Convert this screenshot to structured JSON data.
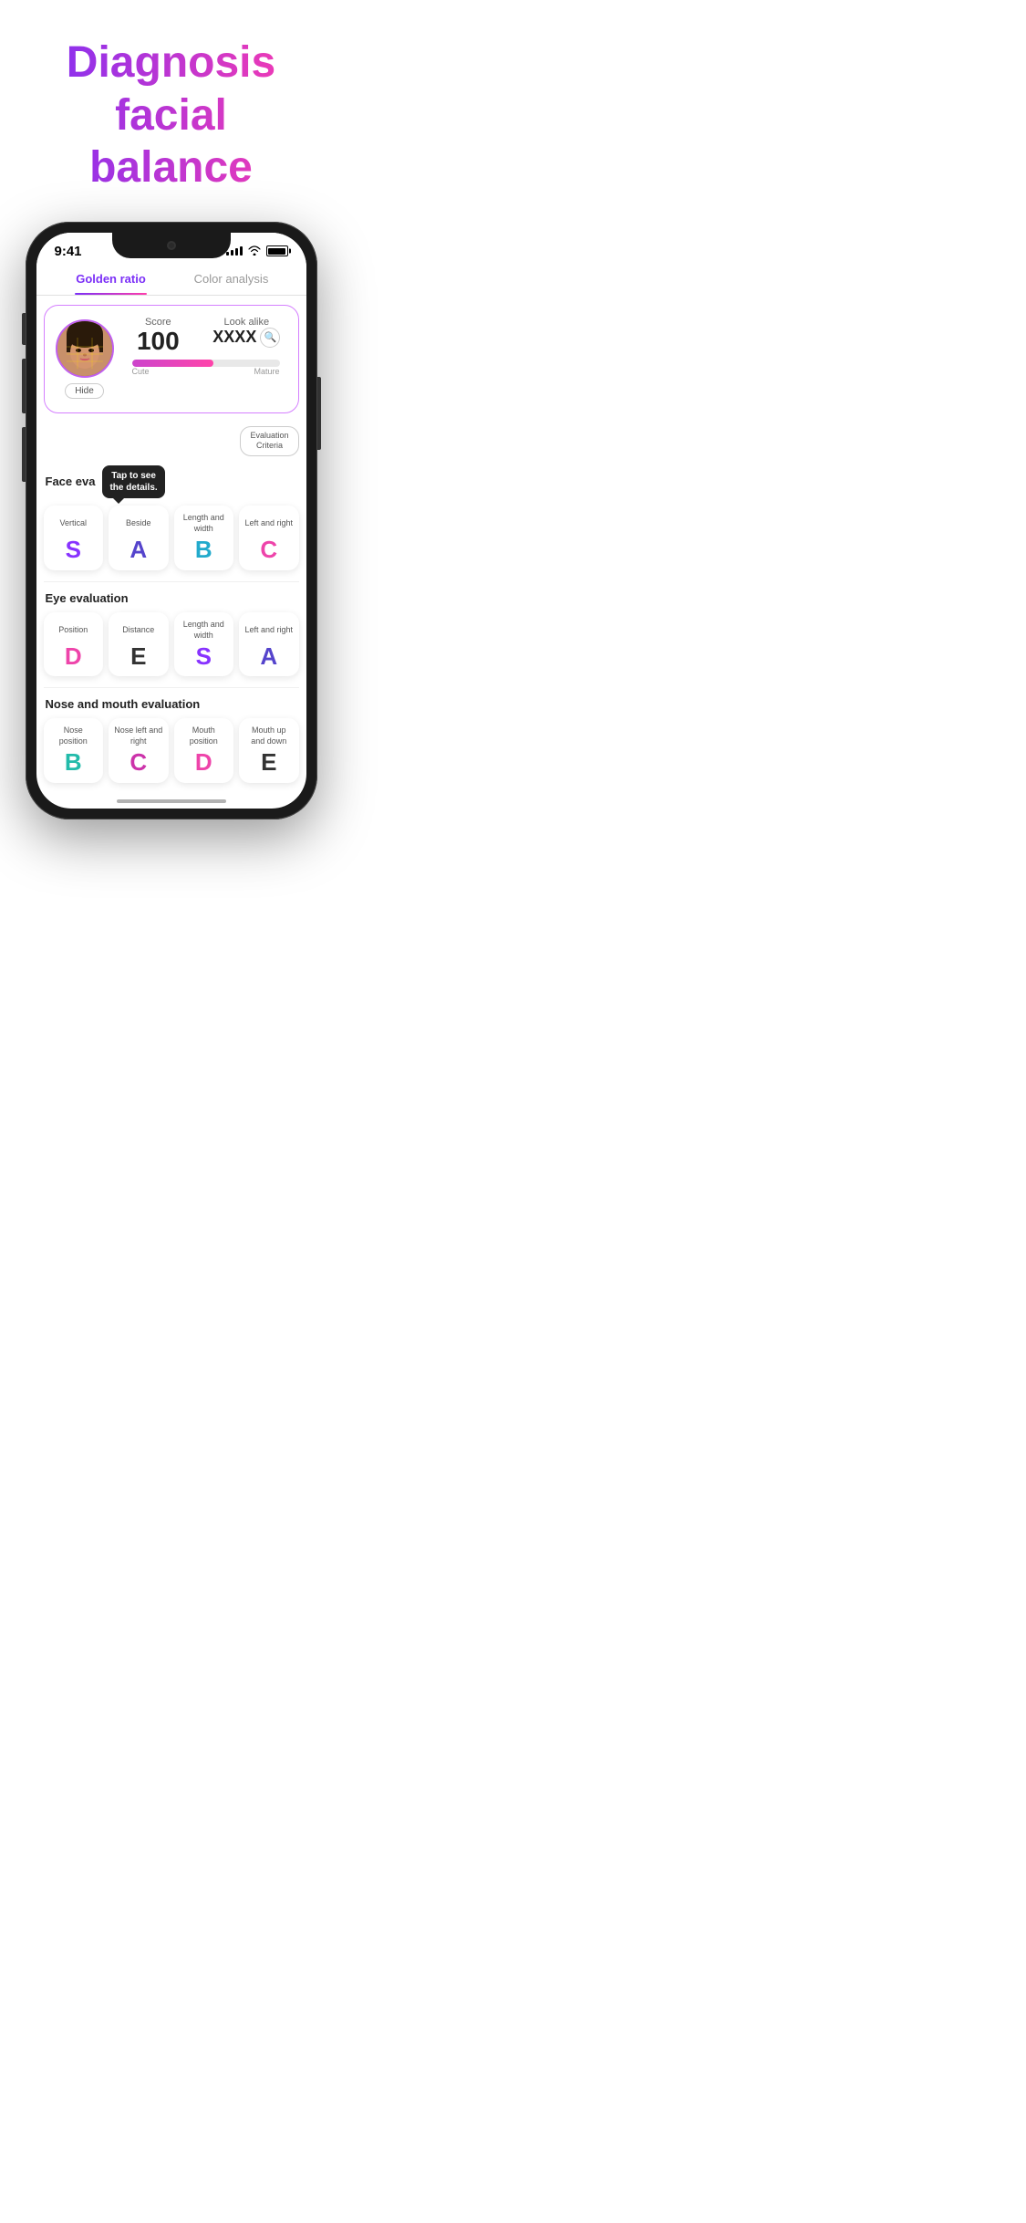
{
  "hero": {
    "title_line1": "Diagnosis facial",
    "title_line2": "balance"
  },
  "phone": {
    "status_bar": {
      "time": "9:41",
      "signal": "●●●●",
      "wifi": "wifi",
      "battery": "battery"
    },
    "tabs": [
      {
        "id": "golden-ratio",
        "label": "Golden ratio",
        "active": true
      },
      {
        "id": "color-analysis",
        "label": "Color analysis",
        "active": false
      }
    ],
    "score_card": {
      "score_label": "Score",
      "score_value": "100",
      "look_alike_label": "Look alike",
      "look_alike_value": "XXXX",
      "hide_label": "Hide",
      "bar_left_label": "Cute",
      "bar_right_label": "Mature",
      "eval_criteria": "Evaluation\nCriteria"
    },
    "face_evaluation": {
      "section_title": "Face eva...",
      "tooltip": "Tap to see\nthe details.",
      "cards": [
        {
          "name": "Vertical",
          "grade": "S",
          "color": "purple"
        },
        {
          "name": "Beside",
          "grade": "A",
          "color": "blue-purple"
        },
        {
          "name": "Length and width",
          "grade": "B",
          "color": "cyan"
        },
        {
          "name": "Left and right",
          "grade": "C",
          "color": "pink"
        }
      ]
    },
    "eye_evaluation": {
      "section_title": "Eye evaluation",
      "cards": [
        {
          "name": "Position",
          "grade": "D",
          "color": "pink"
        },
        {
          "name": "Distance",
          "grade": "E",
          "color": "dark"
        },
        {
          "name": "Length and width",
          "grade": "S",
          "color": "purple"
        },
        {
          "name": "Left and right",
          "grade": "A",
          "color": "blue-purple"
        }
      ]
    },
    "nose_mouth_evaluation": {
      "section_title": "Nose and mouth evaluation",
      "cards": [
        {
          "name": "Nose position",
          "grade": "B",
          "color": "teal"
        },
        {
          "name": "Nose left and right",
          "grade": "C",
          "color": "magenta"
        },
        {
          "name": "Mouth position",
          "grade": "D",
          "color": "pink"
        },
        {
          "name": "Mouth up and down",
          "grade": "E",
          "color": "dark"
        }
      ]
    }
  }
}
